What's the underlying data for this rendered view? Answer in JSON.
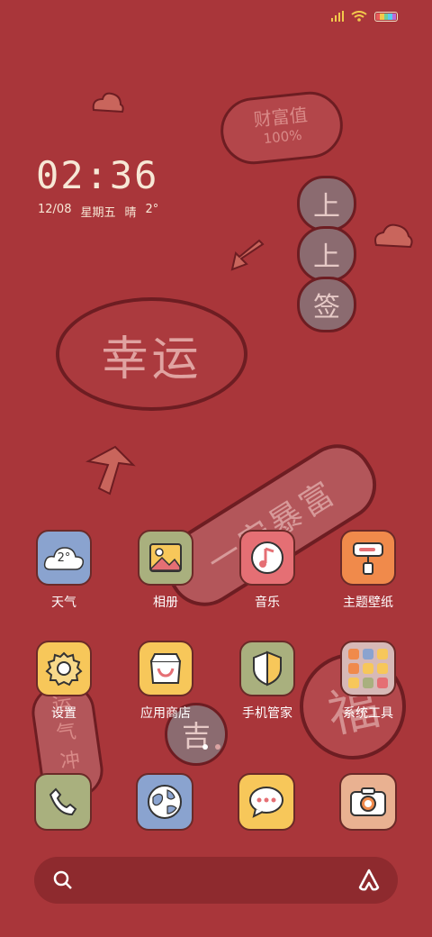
{
  "status_bar": {
    "signal_icon": "signal-icon",
    "wifi_icon": "wifi-icon",
    "battery_icon": "battery-icon",
    "battery_colors": [
      "#e85a5a",
      "#f2c94c",
      "#6fcf97",
      "#56ccf2",
      "#bb6bd9"
    ]
  },
  "clock": {
    "time": "02:36",
    "date": "12/08",
    "weekday": "星期五",
    "weather": "晴",
    "temperature": "2°"
  },
  "wallpaper": {
    "wealth_label": "财富值",
    "wealth_value": "100%",
    "sign_chars": [
      "上",
      "上",
      "签"
    ],
    "luck_text": "幸运",
    "rich_text": "一安暴富",
    "fortune_char": "福",
    "lucky_char": "吉",
    "spirit_text": [
      "运",
      "气",
      "冲"
    ]
  },
  "apps_row1": [
    {
      "label": "天气",
      "icon": "weather-icon",
      "bg": "#8aa3cf",
      "icon_text": "2°"
    },
    {
      "label": "相册",
      "icon": "gallery-icon",
      "bg": "#a9b07e"
    },
    {
      "label": "音乐",
      "icon": "music-icon",
      "bg": "#e56f74"
    },
    {
      "label": "主题壁纸",
      "icon": "theme-icon",
      "bg": "#f08a4b"
    }
  ],
  "apps_row2": [
    {
      "label": "设置",
      "icon": "settings-icon",
      "bg": "#f7c75a"
    },
    {
      "label": "应用商店",
      "icon": "app-store-icon",
      "bg": "#f7c75a"
    },
    {
      "label": "手机管家",
      "icon": "security-icon",
      "bg": "#a9b07e"
    },
    {
      "label": "系统工具",
      "icon": "folder-icon",
      "bg": "#d7b9b7"
    }
  ],
  "dock": [
    {
      "icon": "phone-icon",
      "bg": "#a9b07e"
    },
    {
      "icon": "browser-icon",
      "bg": "#8aa3cf"
    },
    {
      "icon": "messages-icon",
      "bg": "#f7c75a"
    },
    {
      "icon": "camera-icon",
      "bg": "#e9b191"
    }
  ],
  "page_indicator": {
    "pages": 2,
    "current": 1
  },
  "search": {
    "icon": "search-icon",
    "assistant_icon": "assistant-icon"
  }
}
